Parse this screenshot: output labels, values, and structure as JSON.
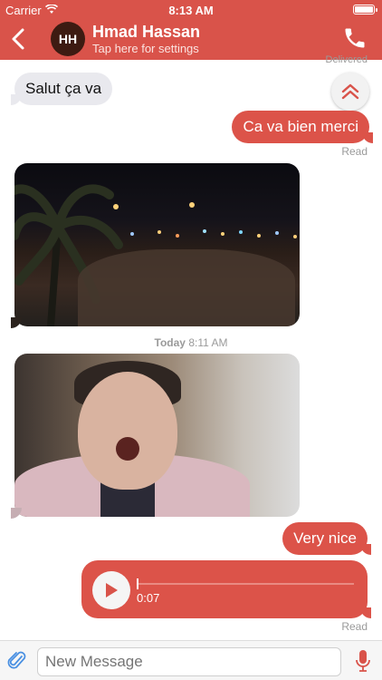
{
  "status": {
    "carrier": "Carrier",
    "time": "8:13 AM"
  },
  "header": {
    "avatar_initials": "HH",
    "contact_name": "Hmad  Hassan",
    "subtitle": "Tap here for settings",
    "accent": "#d9534a"
  },
  "messages": {
    "delivered": "Delivered",
    "incoming_1": "Salut ça va",
    "outgoing_1": "Ca va bien merci",
    "read_1": "Read",
    "timestamp_day": "Today",
    "timestamp_time": "8:11 AM",
    "outgoing_2": "Very nice",
    "voice_duration": "0:07",
    "voice_progress": 0.0,
    "read_2": "Read"
  },
  "composer": {
    "placeholder": "New Message"
  }
}
